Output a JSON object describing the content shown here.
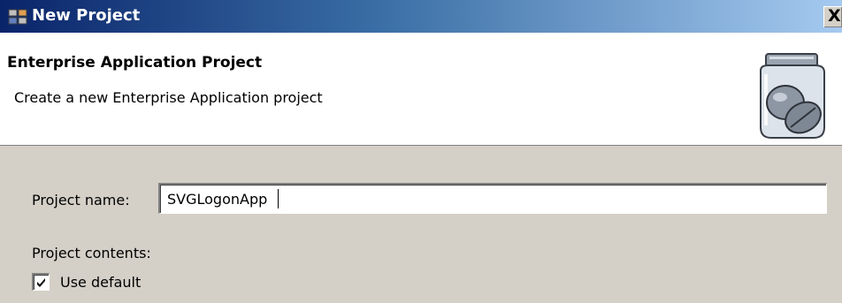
{
  "window": {
    "title": "New Project",
    "close_label": "X"
  },
  "banner": {
    "title": "Enterprise Application Project",
    "description": "Create a new Enterprise Application project"
  },
  "form": {
    "project_name_label": "Project name:",
    "project_name_value": "SVGLogonApp",
    "project_contents_label": "Project contents:",
    "use_default_label": "Use default",
    "use_default_checked": true
  },
  "icons": {
    "app": "new-project-icon",
    "banner": "jar-with-beans-icon",
    "close": "close-icon",
    "check": "check-icon"
  }
}
